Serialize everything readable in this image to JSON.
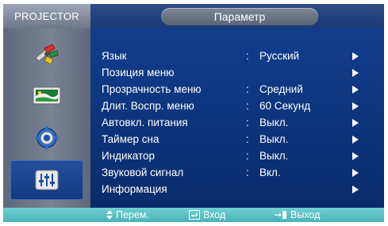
{
  "header": {
    "brand": "PROJECTOR",
    "title": "Параметр"
  },
  "sidebar": {
    "items": [
      {
        "icon": "input-source-icon",
        "active": false
      },
      {
        "icon": "picture-icon",
        "active": false
      },
      {
        "icon": "setup-gear-icon",
        "active": false
      },
      {
        "icon": "option-sliders-icon",
        "active": true
      }
    ]
  },
  "menu": {
    "rows": [
      {
        "label": "Язык",
        "value": "Русский",
        "colon": ":"
      },
      {
        "label": "Позиция меню",
        "value": "",
        "colon": ""
      },
      {
        "label": "Прозрачность меню",
        "value": "Средний",
        "colon": ":"
      },
      {
        "label": "Длит. Воспр. меню",
        "value": "60 Секунд",
        "colon": ":"
      },
      {
        "label": "Автовкл. питания",
        "value": "Выкл.",
        "colon": ":"
      },
      {
        "label": "Таймер  сна",
        "value": "Выкл.",
        "colon": ":"
      },
      {
        "label": "Индикатор",
        "value": "Выкл.",
        "colon": ":"
      },
      {
        "label": "Звуковой сигнал",
        "value": "Вкл.",
        "colon": ":"
      },
      {
        "label": "Информация",
        "value": "",
        "colon": ""
      }
    ]
  },
  "footer": {
    "move_label": "Перем.",
    "enter_label": "Вход",
    "exit_label": "Выход"
  },
  "colors": {
    "panel": "#0b2f7a",
    "footer": "#5cc2c5",
    "accent": "#ffffff"
  }
}
